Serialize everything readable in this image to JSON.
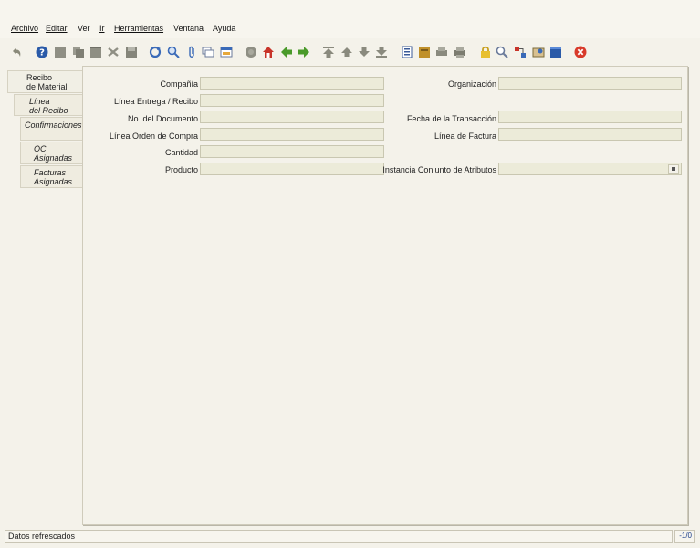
{
  "menu": {
    "archivo": "Archivo",
    "editar": "Editar",
    "ver": "Ver",
    "ir": "Ir",
    "herramientas": "Herramientas",
    "ventana": "Ventana",
    "ayuda": "Ayuda"
  },
  "toolbar": {
    "icons": [
      "undo-icon",
      "help-icon",
      "new-record-icon",
      "copy-record-icon",
      "delete-icon",
      "delete-selection-icon",
      "save-icon",
      "refresh-icon",
      "find-icon",
      "attachment-icon",
      "chat-icon",
      "grid-toggle-icon",
      "history-icon",
      "home-icon",
      "parent-icon",
      "detail-icon",
      "first-record-icon",
      "previous-record-icon",
      "next-record-icon",
      "last-record-icon",
      "report-icon",
      "archive-icon",
      "print-preview-icon",
      "print-icon",
      "lock-icon",
      "zoom-across-icon",
      "workflow-icon",
      "product-info-icon",
      "window-icon",
      "exit-icon"
    ]
  },
  "tabs": [
    {
      "label_line1": "Recibo",
      "label_line2": "de Material"
    },
    {
      "label_line1": "Línea",
      "label_line2": "del Recibo"
    },
    {
      "label_line1": "Confirmaciones",
      "label_line2": ""
    },
    {
      "label_line1": "OC",
      "label_line2": "Asignadas"
    },
    {
      "label_line1": "Facturas",
      "label_line2": "Asignadas"
    }
  ],
  "form": {
    "compania": "Compañía",
    "organizacion": "Organización",
    "linea_entrega": "Línea Entrega / Recibo",
    "no_documento": "No. del Documento",
    "fecha_transaccion": "Fecha de la Transacción",
    "linea_orden": "Línea Orden de Compra",
    "linea_factura": "Línea de Factura",
    "cantidad": "Cantidad",
    "producto": "Producto",
    "instancia": "Instancia Conjunto de Atributos"
  },
  "status": {
    "message": "Datos refrescados",
    "record_count": "-1/0"
  },
  "colors": {
    "background": "#f4f2ea",
    "field_bg": "#ecebd9",
    "exit_red": "#d83a2a"
  }
}
